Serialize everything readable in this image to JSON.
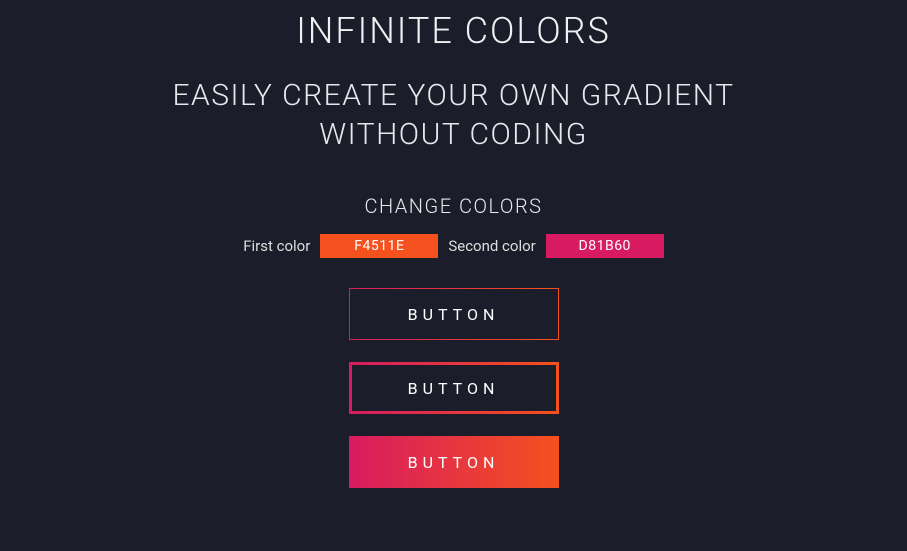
{
  "header": {
    "title": "INFINITE COLORS",
    "subtitle": "EASILY CREATE YOUR OWN GRADIENT WITHOUT CODING"
  },
  "section": {
    "label": "CHANGE COLORS",
    "first_label": "First color",
    "first_value": "F4511E",
    "second_label": "Second color",
    "second_value": "D81B60"
  },
  "colors": {
    "first_hex": "#F4511E",
    "second_hex": "#D81B60"
  },
  "buttons": {
    "outline_thin": "BUTTON",
    "outline_thick": "BUTTON",
    "solid": "BUTTON"
  }
}
